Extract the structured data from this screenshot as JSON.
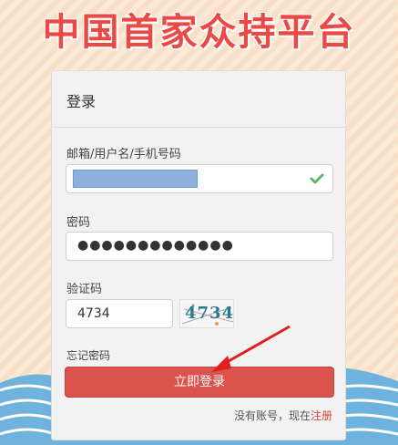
{
  "banner": {
    "title": "中国首家众持平台"
  },
  "login": {
    "header": "登录",
    "username_label": "邮箱/用户名/手机号码",
    "password_label": "密码",
    "password_mask": "●●●●●●●●●●●●●",
    "captcha_label": "验证码",
    "captcha_value": "4734",
    "captcha_image_text": "4734",
    "forgot_link": "忘记密码",
    "submit_button": "立即登录",
    "register_prompt": "没有账号，现在",
    "register_link": "注册"
  },
  "colors": {
    "accent": "#dc524c",
    "check": "#5cb85c",
    "arrow": "#e02020"
  },
  "icons": {
    "username_valid": "check-icon"
  }
}
